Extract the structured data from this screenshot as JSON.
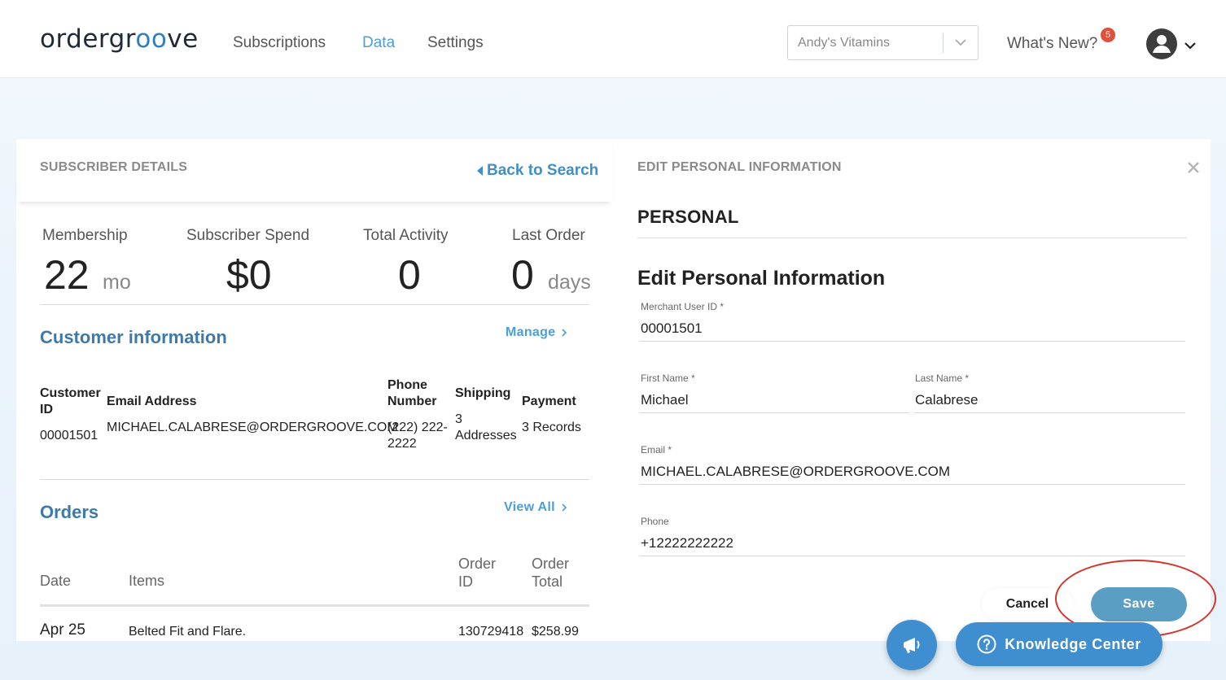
{
  "header": {
    "logo": {
      "part1": "ordergr",
      "part2": "oo",
      "part3": "ve"
    },
    "nav": [
      {
        "label": "Subscriptions"
      },
      {
        "label": "Data"
      },
      {
        "label": "Settings"
      }
    ],
    "store": "Andy's Vitamins",
    "whats_new": "What's New?",
    "badge": "5"
  },
  "left": {
    "caption": "SUBSCRIBER DETAILS",
    "back": "Back to Search",
    "stats": [
      {
        "label": "Membership",
        "value": "22",
        "unit": "mo"
      },
      {
        "label": "Subscriber Spend",
        "value": "$0"
      },
      {
        "label": "Total Activity",
        "value": "0"
      },
      {
        "label": "Last Order",
        "value": "0",
        "unit": "days"
      }
    ],
    "customer": {
      "title": "Customer information",
      "manage": "Manage",
      "headers": {
        "id1": "Customer",
        "id2": "ID",
        "email": "Email Address",
        "phone1": "Phone",
        "phone2": "Number",
        "shipping": "Shipping",
        "payment": "Payment"
      },
      "row": {
        "id": "00001501",
        "email": "MICHAEL.CALABRESE@ORDERGROOVE.COM",
        "phone1": "(222) 222-",
        "phone2": "2222",
        "ship1": "3",
        "ship2": "Addresses",
        "payment": "3 Records"
      }
    },
    "orders": {
      "title": "Orders",
      "view_all": "View All",
      "headers": {
        "date": "Date",
        "items": "Items",
        "oid1": "Order",
        "oid2": "ID",
        "tot1": "Order",
        "tot2": "Total"
      },
      "row": {
        "date": "Apr 25",
        "items": "Belted Fit and Flare.",
        "id": "130729418",
        "total": "$258.99"
      }
    }
  },
  "right": {
    "caption": "EDIT PERSONAL INFORMATION",
    "personal": "PERSONAL",
    "title": "Edit Personal Information",
    "fields": {
      "merchant_id": {
        "label": "Merchant User ID *",
        "value": "00001501"
      },
      "first_name": {
        "label": "First Name *",
        "value": "Michael"
      },
      "last_name": {
        "label": "Last Name *",
        "value": "Calabrese"
      },
      "email": {
        "label": "Email *",
        "value": "MICHAEL.CALABRESE@ORDERGROOVE.COM"
      },
      "phone": {
        "label": "Phone",
        "value": "+12222222222"
      }
    },
    "cancel": "Cancel",
    "save": "Save"
  },
  "footer": {
    "knowledge": "Knowledge Center"
  },
  "colors": {
    "accent": "#3f8fd0",
    "link": "#4a9fd5",
    "save": "#5b9ec4",
    "annotation": "#d3352c",
    "badge": "#e0503a"
  }
}
